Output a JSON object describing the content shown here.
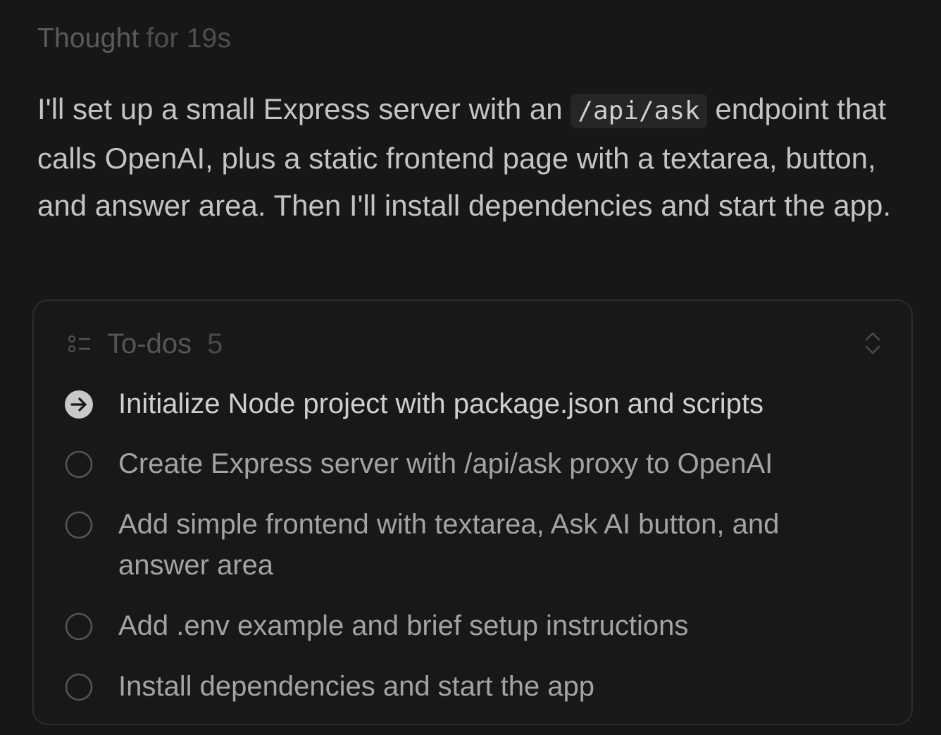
{
  "thought": {
    "label": "Thought",
    "duration": "for 19s"
  },
  "message": {
    "part1": "I'll set up a small Express server with an ",
    "code": "/api/ask",
    "part2": " endpoint that calls OpenAI, plus a static frontend page with a textarea, button, and answer area. Then I'll install dependencies and start the app."
  },
  "todos": {
    "title": "To-dos",
    "count": "5",
    "items": [
      {
        "text": "Initialize Node project with package.json and scripts",
        "status": "in-progress"
      },
      {
        "text": "Create Express server with /api/ask proxy to OpenAI",
        "status": "pending"
      },
      {
        "text": "Add simple frontend with textarea, Ask AI button, and answer area",
        "status": "pending"
      },
      {
        "text": "Add .env example and brief setup instructions",
        "status": "pending"
      },
      {
        "text": "Install dependencies and start the app",
        "status": "pending"
      }
    ]
  },
  "colors": {
    "background": "#171717",
    "panel_border": "#2c2c2c",
    "text": "#c4c4c4",
    "muted": "#555555"
  },
  "icons": {
    "header": "list-icon",
    "expand": "chevron-up-down-icon",
    "in_progress": "arrow-right-circle-icon",
    "pending": "empty-circle-icon"
  }
}
